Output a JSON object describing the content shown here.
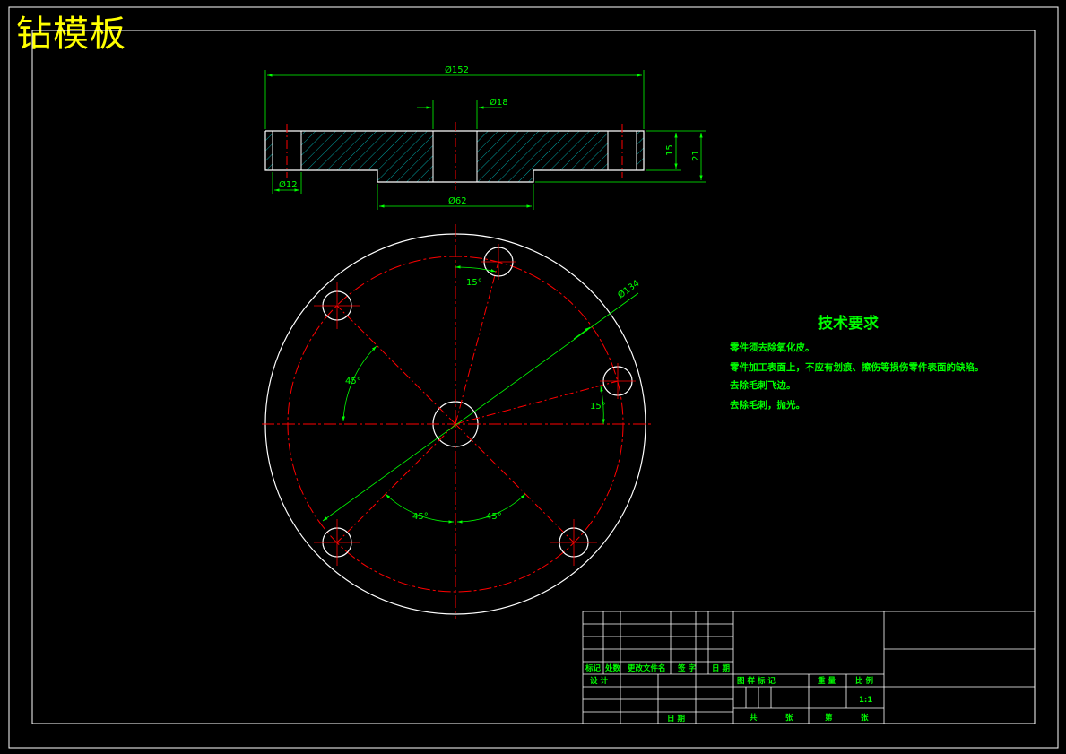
{
  "drawing": {
    "title": "钻模板",
    "dimensions": {
      "outer_diameter": "Ø152",
      "center_hole": "Ø18",
      "bolt_hole": "Ø12",
      "boss_diameter": "Ø62",
      "plate_thickness": "15",
      "total_height": "21",
      "pitch_circle": "Ø134",
      "angle_top": "15°",
      "angle_right": "15°",
      "angle_left": "45°",
      "angle_bottom_left": "45°",
      "angle_bottom_right": "45°"
    },
    "tech_requirements": {
      "title": "技术要求",
      "items": [
        "零件须去除氧化皮。",
        "零件加工表面上，不应有划痕、擦伤等损伤零件表面的缺陷。",
        "去除毛刺飞边。",
        "去除毛刺，抛光。"
      ]
    },
    "title_block": {
      "mark": "标记",
      "count": "处数",
      "change_doc": "更改文件名",
      "signature": "签 字",
      "date": "日 期",
      "design": "设 计",
      "sheet": "日 期",
      "stage_mark": "图 样 标 记",
      "weight": "重 量",
      "scale": "比 例",
      "scale_value": "1:1",
      "total": "共",
      "sheets": "张",
      "page": "第",
      "page_sheets": "张"
    },
    "colors": {
      "outline": "#ffffff",
      "dimension": "#00ff00",
      "center": "#ff0000",
      "hatch": "#00c8c8",
      "title": "#ffff00"
    }
  }
}
